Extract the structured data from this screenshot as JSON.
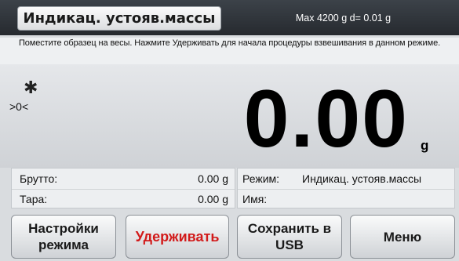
{
  "header": {
    "mode_title": "Индикац. устояв.массы",
    "max_info": "Max 4200 g   d= 0.01 g"
  },
  "instruction": "Поместите образец на весы. Нажмите Удерживать для начала процедуры взвешивания в данном режиме.",
  "display": {
    "stable_symbol": "✱",
    "zero_indicator": ">0<",
    "weight_value": "0.00",
    "unit": "g"
  },
  "info_left": {
    "rows": [
      {
        "label": "Брутто:",
        "value": "0.00 g"
      },
      {
        "label": "Тара:",
        "value": "0.00 g"
      }
    ]
  },
  "info_right": {
    "rows": [
      {
        "label": "Режим:",
        "value": "Индикац. устояв.массы"
      },
      {
        "label": "Имя:",
        "value": ""
      }
    ]
  },
  "buttons": {
    "mode_settings": "Настройки режима",
    "hold": "Удерживать",
    "save_usb": "Сохранить в USB",
    "menu": "Меню"
  },
  "colors": {
    "header_bg": "#2f3439",
    "hold_text": "#d21a1a",
    "screen_bg": "#d9dcdf"
  }
}
